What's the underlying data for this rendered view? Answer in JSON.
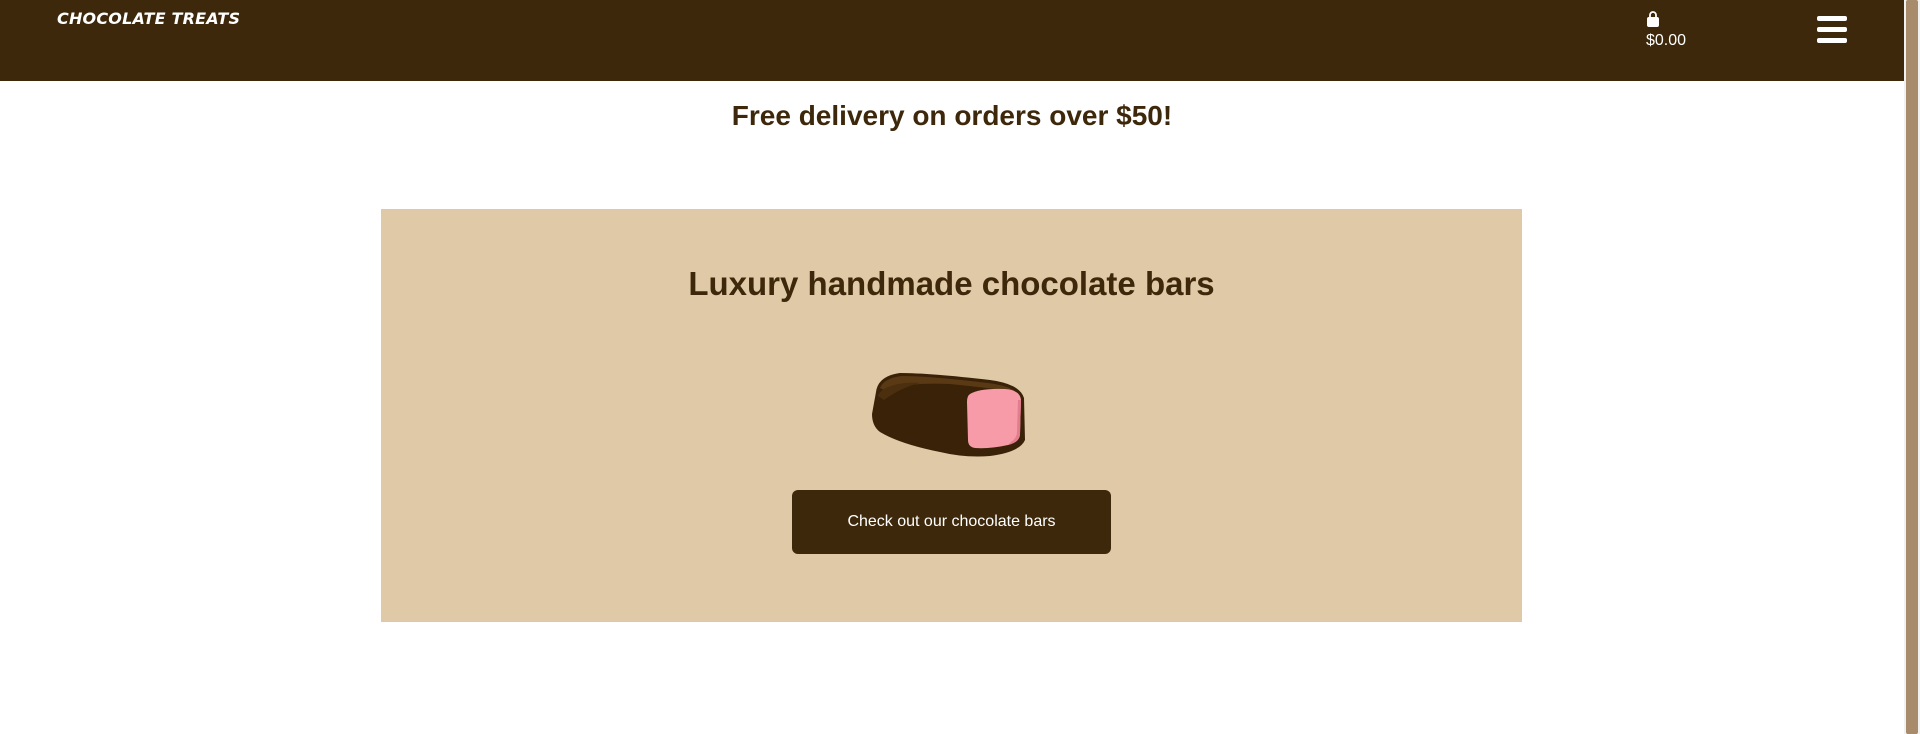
{
  "header": {
    "logo": "CHOCOLATE TREATS",
    "cart_total": "$0.00",
    "cart_icon": "shopping-bag-icon",
    "menu_icon": "hamburger-menu-icon"
  },
  "promo": {
    "text": "Free delivery on orders over $50!"
  },
  "hero": {
    "title": "Luxury handmade chocolate bars",
    "image": "chocolate-bar-illustration",
    "cta_label": "Check out our chocolate bars"
  },
  "colors": {
    "brand_brown": "#3e280b",
    "hero_tan": "#e0c9a6",
    "filling_pink": "#f79ba8"
  }
}
